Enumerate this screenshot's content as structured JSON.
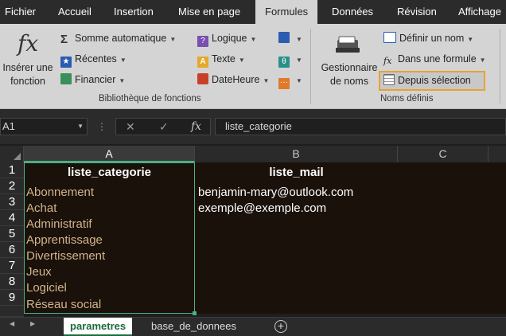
{
  "tabs": [
    "Fichier",
    "Accueil",
    "Insertion",
    "Mise en page",
    "Formules",
    "Données",
    "Révision",
    "Affichage"
  ],
  "ribbon": {
    "insert_function": [
      "Insérer une",
      "fonction"
    ],
    "function_library": {
      "autosum": "Somme automatique",
      "recent": "Récentes",
      "financial": "Financier",
      "logical": "Logique",
      "text": "Texte",
      "datetime": "DateHeure",
      "label": "Bibliothèque de fonctions"
    },
    "names": {
      "manager": [
        "Gestionnaire",
        "de noms"
      ],
      "define_name": "Définir un nom",
      "use_in_formula": "Dans une formule",
      "create_from_selection": "Depuis sélection",
      "label": "Noms définis"
    }
  },
  "formula_bar": {
    "name_box": "A1",
    "fx": "fx",
    "content": "liste_categorie"
  },
  "grid": {
    "columns": [
      "A",
      "B",
      "C"
    ],
    "rows": [
      "1",
      "2",
      "3",
      "4",
      "5",
      "6",
      "7",
      "8",
      "9"
    ],
    "col_a": [
      "liste_categorie",
      "Abonnement",
      "Achat",
      "Administratif",
      "Apprentissage",
      "Divertissement",
      "Jeux",
      "Logiciel",
      "Réseau social"
    ],
    "col_b": [
      "liste_mail",
      "benjamin-mary@outlook.com",
      "exemple@exemple.com"
    ]
  },
  "sheets": [
    "parametres",
    "base_de_donnees"
  ],
  "colors": {
    "accent_green": "#4caf85",
    "highlight_orange": "#e8a13a",
    "cell_text_tan": "#d2b48c"
  }
}
